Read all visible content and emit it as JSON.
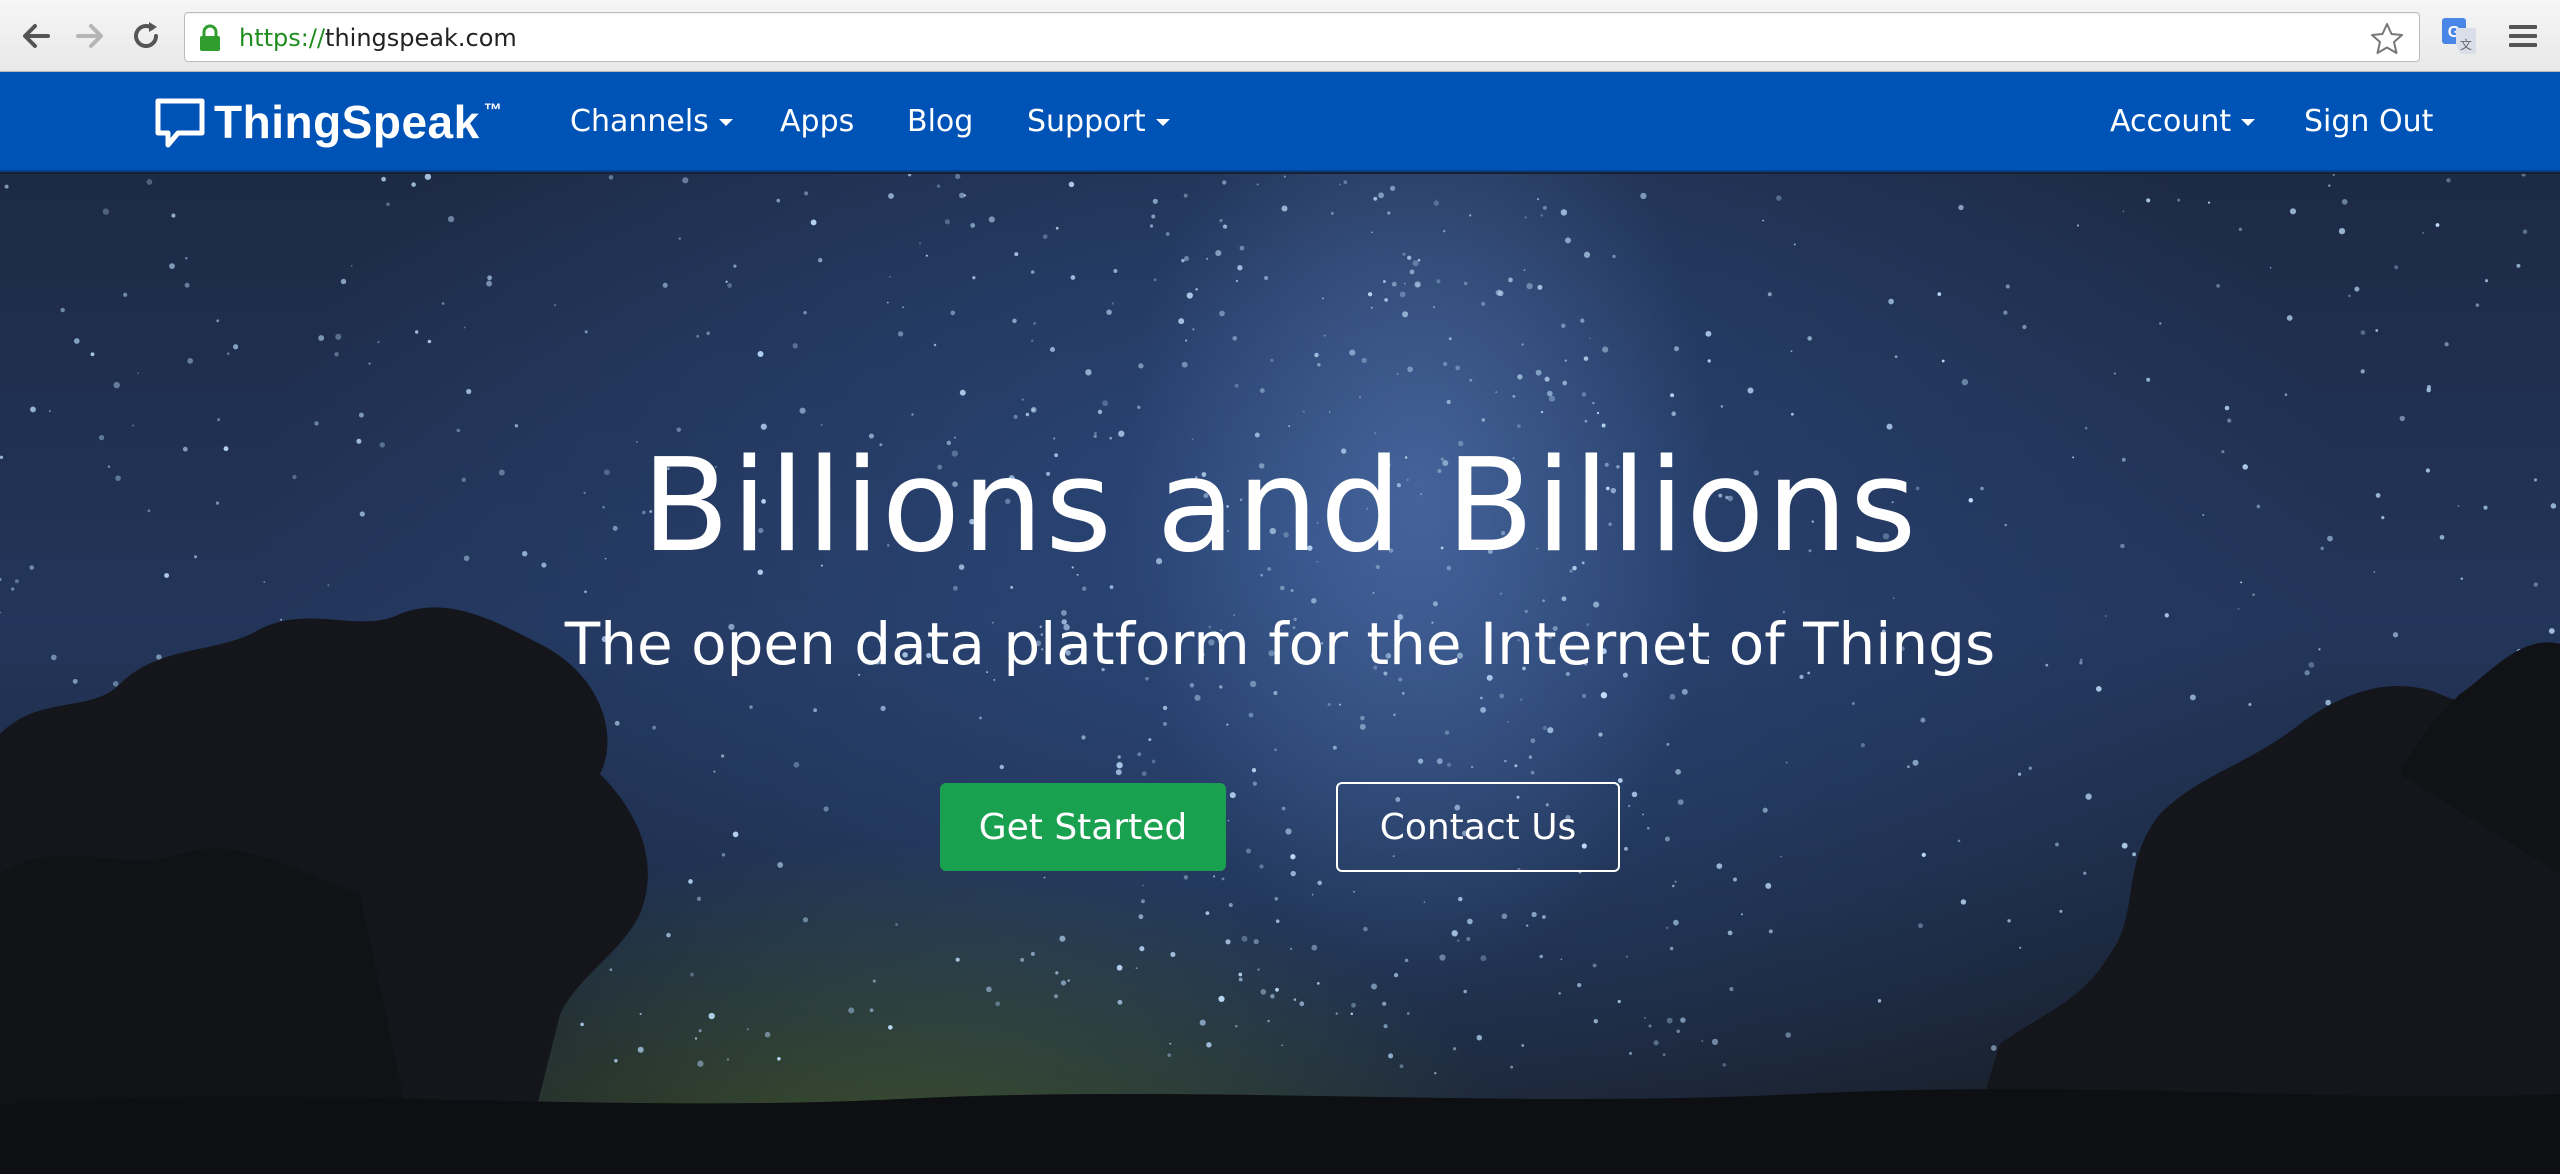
{
  "browser": {
    "url_scheme": "https://",
    "url_host": "thingspeak.com"
  },
  "nav": {
    "brand": "ThingSpeak",
    "brand_tm": "™",
    "items": [
      {
        "label": "Channels"
      },
      {
        "label": "Apps"
      },
      {
        "label": "Blog"
      },
      {
        "label": "Support"
      }
    ],
    "right_items": [
      {
        "label": "Account"
      },
      {
        "label": "Sign Out"
      }
    ],
    "bar_color": "#0053b6"
  },
  "hero": {
    "title": "Billions and Billions",
    "subtitle": "The open data platform for the Internet of Things",
    "primary_button": "Get Started",
    "secondary_button": "Contact Us",
    "primary_color": "#1aa150"
  },
  "icons": {
    "back": "arrow-left-icon",
    "forward": "arrow-right-icon",
    "reload": "reload-icon",
    "lock": "lock-icon",
    "bookmark": "star-icon",
    "extension": "google-translate-icon",
    "menu": "hamburger-menu-icon",
    "logo": "speech-bubble-icon"
  }
}
